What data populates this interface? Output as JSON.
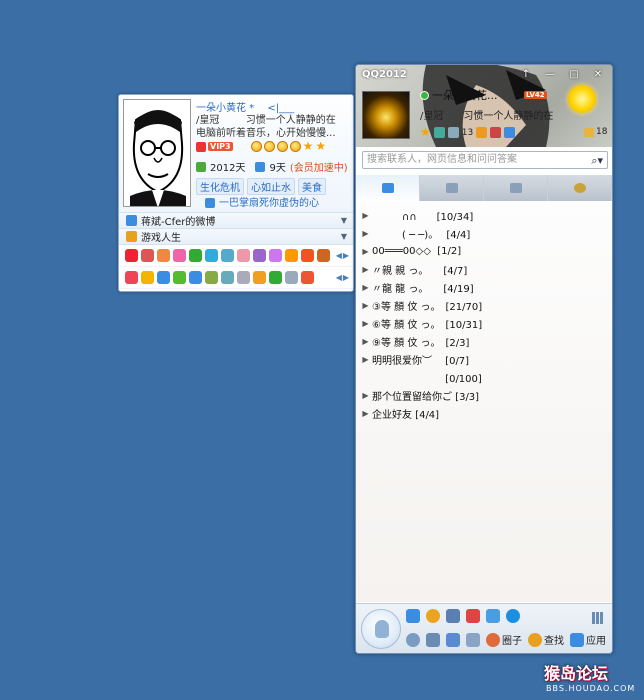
{
  "card": {
    "name": "一朵小黄花 *",
    "name_extra": "<|___",
    "signature_line1": "/皇冠 　　 习惯一个人静静的在",
    "signature_line2": "电脑前听着音乐，心开始慢慢...",
    "vip_label": "VIP3",
    "join_year": "2012天",
    "accel_days": "9天",
    "accel_label": "(会员加速中)",
    "tags": [
      "生化危机",
      "心如止水",
      "美食"
    ],
    "link_text": "一巴掌扇死你虚伪的心",
    "rows": [
      {
        "label": "蒋斌-Cfer的微博"
      },
      {
        "label": "游戏人生"
      }
    ]
  },
  "qq": {
    "title": "QQ2012",
    "window_buttons": [
      "↑",
      "—",
      "□",
      "✕"
    ],
    "nickname": "一朵小黄花...",
    "level": "LV42",
    "signature": "/皇冠　　习惯一个人静静的在",
    "tray_count": "13",
    "mail_count": "18",
    "search_placeholder": "搜索联系人，网页信息和问问答案",
    "groups": [
      {
        "label": "　　　∩∩　　[10/34]"
      },
      {
        "label": "　　　( ─ ─)。　 [4/4]"
      },
      {
        "label": "00═══00◇◇  [1/2]"
      },
      {
        "label": "〃親 親 っ。　　[4/7]"
      },
      {
        "label": "〃龍 龍 っ。　　[4/19]"
      },
      {
        "label": "③等 顏 伩 っ。　[21/70]"
      },
      {
        "label": "⑥等 顏 伩 っ。　[10/31]"
      },
      {
        "label": "⑨等 顏 伩 っ。　[2/3]"
      },
      {
        "label": "明明很爱你︶　 [0/7]"
      },
      {
        "label": "　　　　　　　 [0/100]"
      },
      {
        "label": "那个位置留给你ご [3/3]"
      },
      {
        "label": "企业好友 [4/4]"
      }
    ],
    "footer": {
      "circle_label": "圈子",
      "search_label": "查找",
      "apps_label": "应用"
    }
  },
  "watermark": {
    "text": "猴岛论坛",
    "url": "BBS.HOUDAO.COM"
  }
}
